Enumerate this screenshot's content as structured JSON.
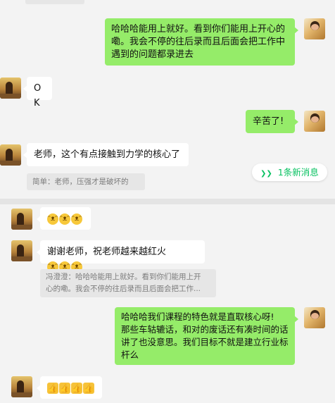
{
  "chat": {
    "top": {
      "msg1": {
        "lines": [
          "哈哈哈能用上就好。看到你们能用上开心的",
          "嘞。我会不停的往后录而且后面会把工作中",
          "遇到的问题都录进去"
        ]
      },
      "msg2": {
        "text": "OK"
      },
      "msg3": {
        "text": "辛苦了!"
      },
      "msg4": {
        "text": "老师，这个有点接触到力学的核心了"
      },
      "quote1": {
        "text": "简单：老师，压强才是破坏的"
      },
      "new_messages": {
        "icon": "double-chevron-down-icon",
        "label": "1条新消息"
      }
    },
    "bottom": {
      "msg5": {
        "emojis": [
          "cat-face-emoji",
          "cat-face-emoji",
          "cat-face-emoji"
        ]
      },
      "msg6": {
        "text": "谢谢老师，祝老师越来越红火",
        "emojis": [
          "cat-face-emoji",
          "cat-face-emoji",
          "cat-face-emoji"
        ]
      },
      "quote2": {
        "lines": [
          "冯澄澄：哈哈哈能用上就好。看到你们能用上开",
          "心的嘞。我会不停的往后录而且后面会把工作..."
        ]
      },
      "msg7": {
        "lines": [
          "哈哈哈我们课程的特色就是直取核心呀!",
          "那些车轱辘话，和对的废话还有凑时间的话",
          "讲了也没意思。我们目标不就是建立行业标",
          "杆么"
        ]
      },
      "msg8": {
        "emojis": [
          "thumbs-up-emoji",
          "thumbs-up-emoji",
          "thumbs-up-emoji",
          "thumbs-up-emoji"
        ]
      }
    }
  },
  "colors": {
    "sent_bubble": "#95ec69",
    "received_bubble": "#ffffff",
    "background": "#f3f3f3",
    "accent": "#07c160"
  }
}
